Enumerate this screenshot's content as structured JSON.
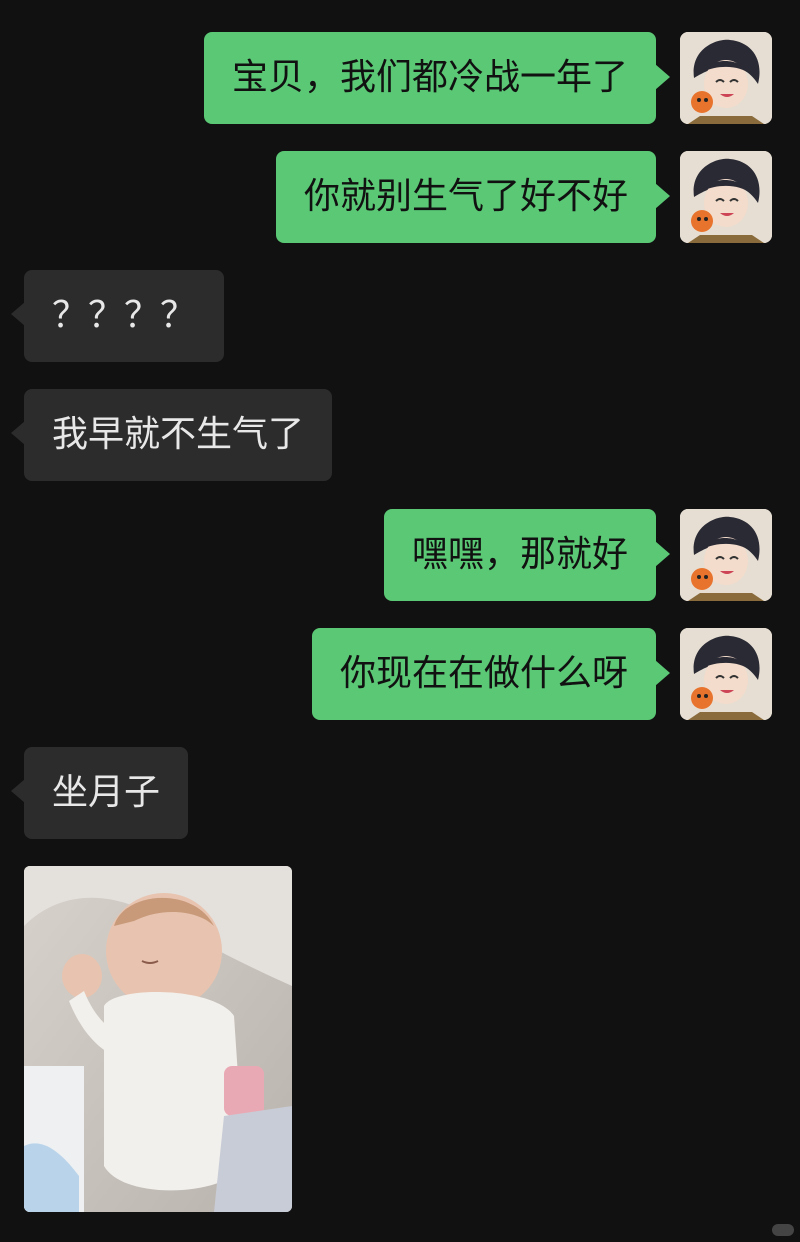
{
  "messages": [
    {
      "side": "out",
      "text": "宝贝，我们都冷战一年了"
    },
    {
      "side": "out",
      "text": "你就别生气了好不好"
    },
    {
      "side": "in",
      "text": "？？？？"
    },
    {
      "side": "in",
      "text": "我早就不生气了"
    },
    {
      "side": "out",
      "text": "嘿嘿，那就好"
    },
    {
      "side": "out",
      "text": "你现在在做什么呀"
    },
    {
      "side": "in",
      "text": "坐月子"
    }
  ],
  "colors": {
    "background": "#111111",
    "outgoing_bubble": "#5ac875",
    "incoming_bubble": "#2c2c2c"
  },
  "icons": {
    "avatar": "anime-boy-avatar-icon",
    "image_message": "baby-photo"
  }
}
